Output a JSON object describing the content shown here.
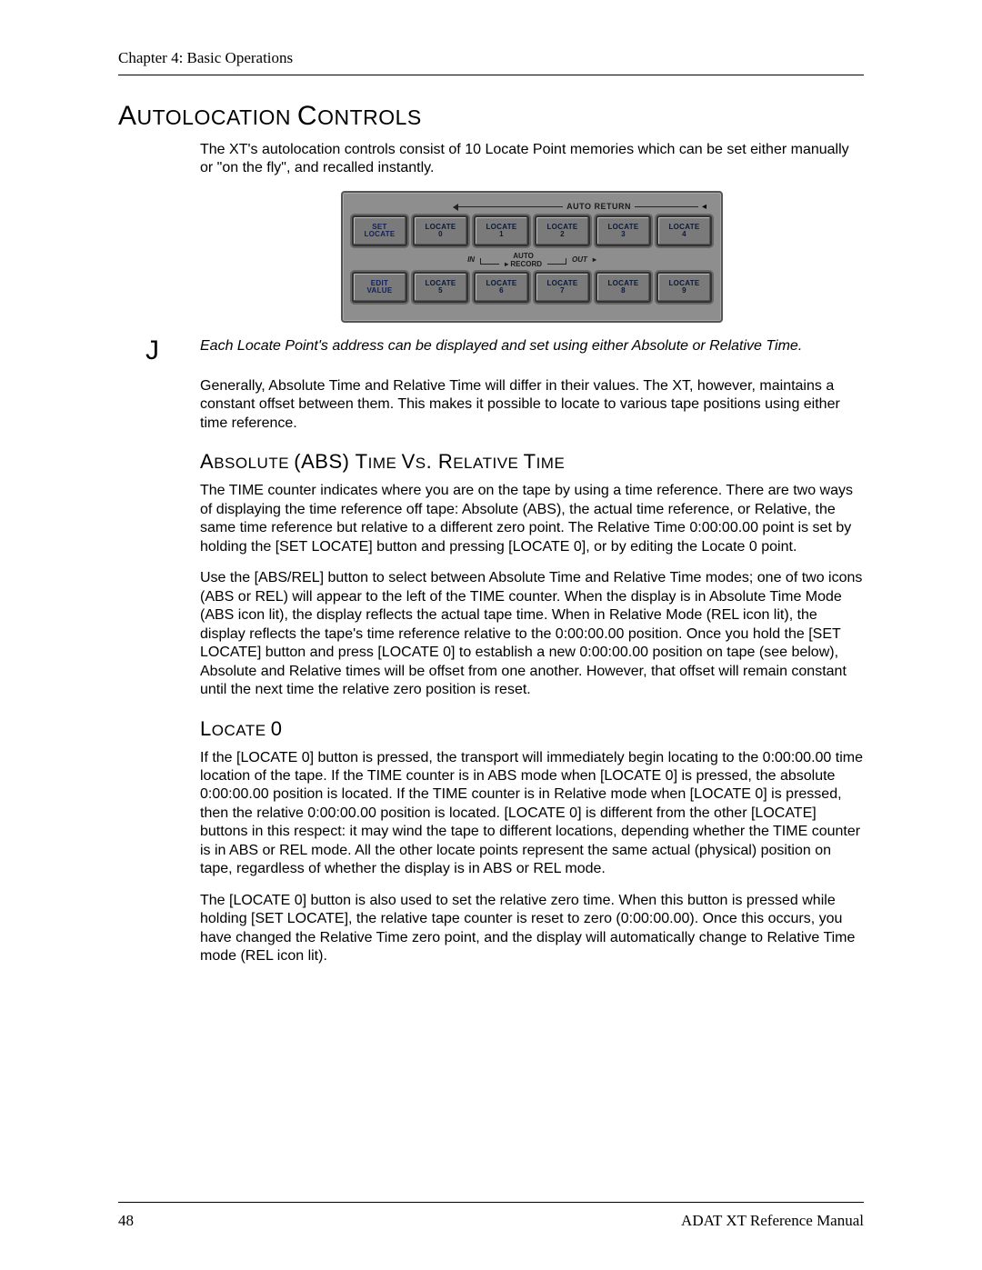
{
  "header": {
    "chapter": "Chapter 4: Basic Operations"
  },
  "section1": {
    "title_parts": [
      "A",
      "UTOLOCATION ",
      "C",
      "ONTROLS"
    ],
    "intro": "The XT's autolocation controls consist of 10 Locate Point memories which can be set either manually or \"on the fly\", and recalled instantly."
  },
  "panel": {
    "auto_return": "AUTO RETURN",
    "row1": [
      {
        "l1": "SET",
        "l2": "LOCATE"
      },
      {
        "l1": "LOCATE",
        "l2": "0"
      },
      {
        "l1": "LOCATE",
        "l2": "1"
      },
      {
        "l1": "LOCATE",
        "l2": "2"
      },
      {
        "l1": "LOCATE",
        "l2": "3"
      },
      {
        "l1": "LOCATE",
        "l2": "4"
      }
    ],
    "inter": {
      "in": "IN",
      "auto_l1": "AUTO",
      "auto_l2": "RECORD",
      "out": "OUT"
    },
    "row2": [
      {
        "l1": "EDIT",
        "l2": "VALUE"
      },
      {
        "l1": "LOCATE",
        "l2": "5"
      },
      {
        "l1": "LOCATE",
        "l2": "6"
      },
      {
        "l1": "LOCATE",
        "l2": "7"
      },
      {
        "l1": "LOCATE",
        "l2": "8"
      },
      {
        "l1": "LOCATE",
        "l2": "9"
      }
    ]
  },
  "note": {
    "marker": "J",
    "text": "Each Locate Point's address can be displayed and set using either Absolute or Relative Time."
  },
  "para_after_note": "Generally, Absolute Time and Relative Time will differ in their values. The XT, however, maintains a constant offset between them. This makes it possible to locate to various tape positions using either time reference.",
  "section2": {
    "title_parts": [
      "A",
      "BSOLUTE ",
      "(ABS) T",
      "IME ",
      "V",
      "S",
      ". R",
      "ELATIVE ",
      "T",
      "IME"
    ],
    "p1": "The TIME counter indicates where you are on the tape by using a time reference. There are two ways of displaying the time reference off tape: Absolute (ABS), the actual time reference, or Relative, the same time reference but relative to a different zero point. The Relative Time 0:00:00.00 point is set by holding the [SET LOCATE] button and pressing [LOCATE 0], or by editing the Locate 0 point.",
    "p2": "Use the [ABS/REL] button to select between Absolute Time and Relative Time modes; one of two icons (ABS or REL) will appear to the left of the TIME counter. When the display is in Absolute Time Mode (ABS icon lit), the display reflects the actual tape time.  When in Relative Mode (REL icon lit), the display reflects the tape's time reference relative to the 0:00:00.00 position. Once you hold the [SET LOCATE] button and press [LOCATE 0] to establish a new 0:00:00.00 position on tape (see below), Absolute and Relative times will be offset from one another. However, that offset will remain constant until the next time the relative zero position is reset."
  },
  "section3": {
    "title_parts": [
      "L",
      "OCATE ",
      "0"
    ],
    "p1": "If the [LOCATE 0] button is pressed, the transport will immediately begin locating to the 0:00:00.00 time location of the tape. If the TIME counter is in ABS mode when [LOCATE 0] is pressed, the absolute 0:00:00.00 position is located. If the TIME counter is in Relative mode when [LOCATE 0] is pressed, then the relative 0:00:00.00 position is located. [LOCATE 0] is different from the other [LOCATE] buttons in this respect:  it may wind the tape to different locations, depending whether the TIME counter is in ABS or REL mode. All the other locate points represent the same actual (physical) position on tape, regardless of whether the display is in ABS or REL mode.",
    "p2": "The [LOCATE 0] button is also used to set the relative zero time.  When this button is pressed while holding [SET LOCATE], the relative tape counter is reset to zero (0:00:00.00). Once this occurs, you have changed the Relative Time zero point, and the display will automatically change to Relative Time mode (REL icon lit)."
  },
  "footer": {
    "page": "48",
    "manual": "ADAT XT Reference Manual"
  }
}
